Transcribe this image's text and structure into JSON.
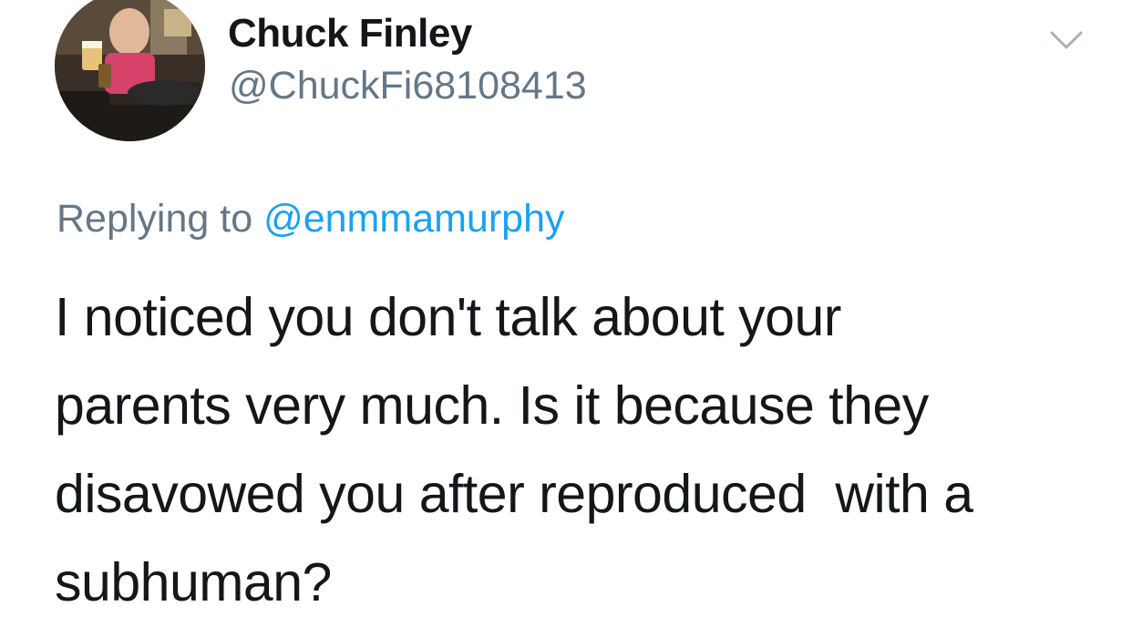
{
  "tweet": {
    "author": {
      "display_name": "Chuck Finley",
      "handle": "@ChuckFi68108413",
      "avatar": "profile-photo"
    },
    "menu_icon": "chevron-down-icon",
    "reply": {
      "prefix": "Replying to ",
      "mention": "@enmmamurphy"
    },
    "text": "I noticed you don't talk about your\nparents very much. Is it because they\ndisavowed you after reproduced  with a\nsubhuman?"
  },
  "colors": {
    "text_primary": "#14171a",
    "text_secondary": "#657786",
    "link": "#1da1f2",
    "background": "#ffffff"
  }
}
